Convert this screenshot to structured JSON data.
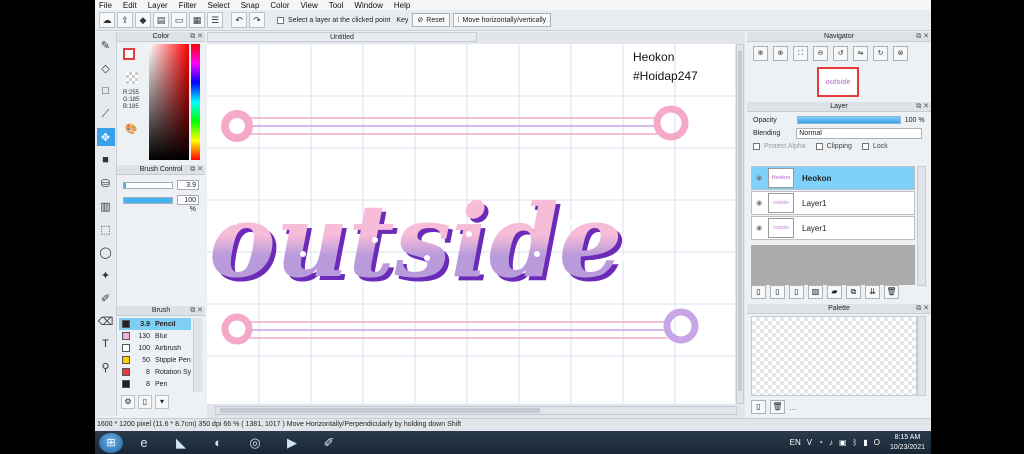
{
  "menu": [
    "File",
    "Edit",
    "Layer",
    "Filter",
    "Select",
    "Snap",
    "Color",
    "View",
    "Tool",
    "Window",
    "Help"
  ],
  "toolbar": {
    "icons": [
      "cloud-icon",
      "export-icon",
      "shape-icon",
      "layers-icon",
      "window-icon",
      "grid-icon",
      "list-icon",
      "undo-icon",
      "redo-icon"
    ],
    "select_layer_label": "Select a layer at the clicked point",
    "key_label": "Key",
    "reset_label": "Reset",
    "move_label": "Move horizontally/vertically"
  },
  "tools": [
    "brush-tool-icon",
    "eraser-tool-icon",
    "rectangle-tool-icon",
    "line-tool-icon",
    "move-tool-icon",
    "fill-rect-tool-icon",
    "bucket-tool-icon",
    "gradient-tool-icon",
    "select-rect-tool-icon",
    "lasso-tool-icon",
    "magic-wand-tool-icon",
    "select-pen-tool-icon",
    "select-eraser-tool-icon",
    "text-tool-icon",
    "eyedropper-tool-icon"
  ],
  "color_panel": {
    "title": "Color",
    "r": "R:255",
    "g": "G:185",
    "b": "B:185",
    "foreground": "#ffffff",
    "accent": "#e53b3b"
  },
  "brush_control": {
    "title": "Brush Control",
    "size": "3.9",
    "size_fraction": 0.04,
    "opacity": "100 %",
    "opacity_fraction": 1.0
  },
  "brush": {
    "title": "Brush",
    "items": [
      {
        "size": "3.9",
        "name": "Pencil",
        "color": "#222222",
        "selected": true
      },
      {
        "size": "130",
        "name": "Blur",
        "color": "#f3b0e6",
        "selected": false
      },
      {
        "size": "100",
        "name": "Airbrush",
        "color": "#ffffff",
        "selected": false
      },
      {
        "size": "50",
        "name": "Stipple Pen",
        "color": "#f4d300",
        "selected": false
      },
      {
        "size": "8",
        "name": "Rotation Sy",
        "color": "#e53b3b",
        "selected": false
      },
      {
        "size": "8",
        "name": "Pen",
        "color": "#222222",
        "selected": false
      }
    ]
  },
  "document": {
    "tab": "Untitled",
    "watermark_line1": "Heokon",
    "watermark_line2": "#Hoidap247",
    "artwork_text": "outside"
  },
  "navigator": {
    "title": "Navigator",
    "thumb_text": "outside"
  },
  "layer_panel": {
    "title": "Layer",
    "opacity_label": "Opacity",
    "opacity_value": "100 %",
    "opacity_fraction": 1.0,
    "blending_label": "Blending",
    "blending_value": "Normal",
    "protect_alpha": "Protect Alpha",
    "clipping": "Clipping",
    "lock": "Lock",
    "layers": [
      {
        "name": "Heokon",
        "selected": true,
        "thumb": "Heokon"
      },
      {
        "name": "Layer1",
        "selected": false,
        "thumb": "outside"
      },
      {
        "name": "Layer1",
        "selected": false,
        "thumb": "outside"
      }
    ]
  },
  "palette": {
    "title": "Palette"
  },
  "status": "1600 * 1200 pixel   (11.6 * 8.7cm)   350 dpi   66 %   ( 1381, 1017 )   Move Horizontally/Perpendicularly by holding down Shift",
  "taskbar": {
    "apps": [
      "internet-explorer-icon",
      "visual-studio-icon",
      "app-icon",
      "chrome-icon",
      "youtube-app-icon",
      "paint-app-icon"
    ],
    "language": "EN",
    "time": "8:15 AM",
    "date": "10/23/2021"
  },
  "colors": {
    "letter_top": "#f7bcd8",
    "letter_bottom": "#b99bdb",
    "letter_shadow": "#6b2bb8",
    "rail_pink": "#f5a9c9",
    "rail_purple": "#c8a5e6",
    "selection_blue": "#7fd0fb"
  }
}
